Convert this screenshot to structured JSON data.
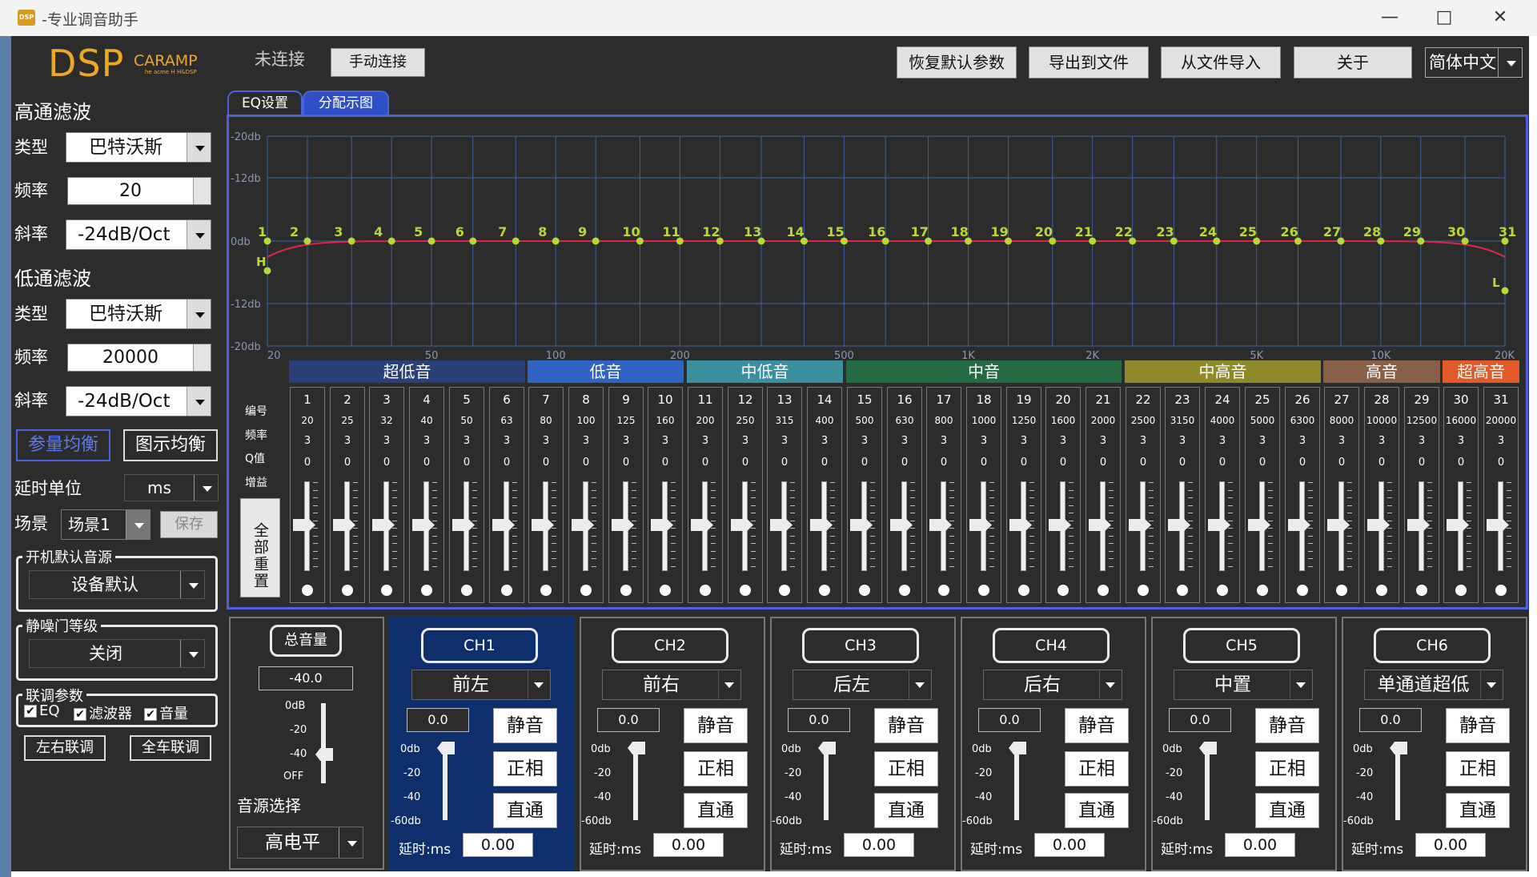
{
  "window": {
    "icon_text": "DSP",
    "title": "-专业调音助手"
  },
  "logo": {
    "main": "DSP",
    "sub": "CARAMP",
    "tag": "he acme H H&DSP"
  },
  "toolbar": {
    "status": "未连接",
    "connect": "手动连接",
    "restore": "恢复默认参数",
    "export": "导出到文件",
    "import": "从文件导入",
    "about": "关于",
    "language": "简体中文"
  },
  "hpf": {
    "title": "高通滤波",
    "type_label": "类型",
    "type": "巴特沃斯",
    "freq_label": "频率",
    "freq": "20",
    "slope_label": "斜率",
    "slope": "-24dB/Oct"
  },
  "lpf": {
    "title": "低通滤波",
    "type_label": "类型",
    "type": "巴特沃斯",
    "freq_label": "频率",
    "freq": "20000",
    "slope_label": "斜率",
    "slope": "-24dB/Oct"
  },
  "mode": {
    "param_eq": "参量均衡",
    "graphic_eq": "图示均衡"
  },
  "delay_unit": {
    "label": "延时单位",
    "value": "ms"
  },
  "scene": {
    "label": "场景",
    "value": "场景1",
    "save": "保存"
  },
  "startup": {
    "title": "开机默认音源",
    "value": "设备默认"
  },
  "noise_gate": {
    "title": "静噪门等级",
    "value": "关闭"
  },
  "link": {
    "title": "联调参数",
    "eq": "EQ",
    "filter": "滤波器",
    "volume": "音量",
    "lr": "左右联调",
    "all": "全车联调"
  },
  "tabs": {
    "eq": "EQ设置",
    "dist": "分配示图"
  },
  "chart_data": {
    "type": "line",
    "y_ticks": [
      "-20db",
      "-12db",
      "0db",
      "-12db",
      "-20db"
    ],
    "x_ticks": [
      "20",
      "50",
      "100",
      "200",
      "500",
      "1K",
      "2K",
      "5K",
      "10K",
      "20K"
    ],
    "markers": [
      "1",
      "2",
      "3",
      "4",
      "5",
      "6",
      "7",
      "8",
      "9",
      "10",
      "11",
      "12",
      "13",
      "14",
      "15",
      "16",
      "17",
      "18",
      "19",
      "20",
      "21",
      "22",
      "23",
      "24",
      "25",
      "26",
      "27",
      "28",
      "29",
      "30",
      "31"
    ],
    "h_label": "H",
    "l_label": "L",
    "gain_db": [
      0,
      0,
      0,
      0,
      0,
      0,
      0,
      0,
      0,
      0,
      0,
      0,
      0,
      0,
      0,
      0,
      0,
      0,
      0,
      0,
      0,
      0,
      0,
      0,
      0,
      0,
      0,
      0,
      0,
      0,
      0
    ]
  },
  "bands": [
    {
      "name": "超低音",
      "color": "#2b3f78"
    },
    {
      "name": "低音",
      "color": "#2f63c4"
    },
    {
      "name": "中低音",
      "color": "#3c8fa0"
    },
    {
      "name": "中音",
      "color": "#236b43"
    },
    {
      "name": "中高音",
      "color": "#8f8a28"
    },
    {
      "name": "高音",
      "color": "#8a5f48"
    },
    {
      "name": "超高音",
      "color": "#e25a2a"
    }
  ],
  "eq_row_labels": {
    "num": "编号",
    "freq": "频率",
    "q": "Q值",
    "gain": "增益",
    "reset": "全部重置"
  },
  "eq_bands": {
    "freqs": [
      "20",
      "25",
      "32",
      "40",
      "50",
      "63",
      "80",
      "100",
      "125",
      "160",
      "200",
      "250",
      "315",
      "400",
      "500",
      "630",
      "800",
      "1000",
      "1250",
      "1600",
      "2000",
      "2500",
      "3150",
      "4000",
      "5000",
      "6300",
      "8000",
      "10000",
      "12500",
      "16000",
      "20000"
    ],
    "q": "3",
    "gain": "0"
  },
  "master": {
    "title": "总音量",
    "value": "-40.0",
    "scale": [
      "0dB",
      "-20",
      "-40",
      "OFF"
    ],
    "source_label": "音源选择",
    "source": "高电平"
  },
  "ch_scale": [
    "0db",
    "-20",
    "-40",
    "-60db"
  ],
  "channels": [
    {
      "name": "CH1",
      "pos": "前左",
      "vol": "0.0",
      "mute": "静音",
      "phase": "正相",
      "bypass": "直通",
      "delay_label": "延时:ms",
      "delay": "0.00"
    },
    {
      "name": "CH2",
      "pos": "前右",
      "vol": "0.0",
      "mute": "静音",
      "phase": "正相",
      "bypass": "直通",
      "delay_label": "延时:ms",
      "delay": "0.00"
    },
    {
      "name": "CH3",
      "pos": "后左",
      "vol": "0.0",
      "mute": "静音",
      "phase": "正相",
      "bypass": "直通",
      "delay_label": "延时:ms",
      "delay": "0.00"
    },
    {
      "name": "CH4",
      "pos": "后右",
      "vol": "0.0",
      "mute": "静音",
      "phase": "正相",
      "bypass": "直通",
      "delay_label": "延时:ms",
      "delay": "0.00"
    },
    {
      "name": "CH5",
      "pos": "中置",
      "vol": "0.0",
      "mute": "静音",
      "phase": "正相",
      "bypass": "直通",
      "delay_label": "延时:ms",
      "delay": "0.00"
    },
    {
      "name": "CH6",
      "pos": "单通道超低",
      "vol": "0.0",
      "mute": "静音",
      "phase": "正相",
      "bypass": "直通",
      "delay_label": "延时:ms",
      "delay": "0.00"
    }
  ]
}
